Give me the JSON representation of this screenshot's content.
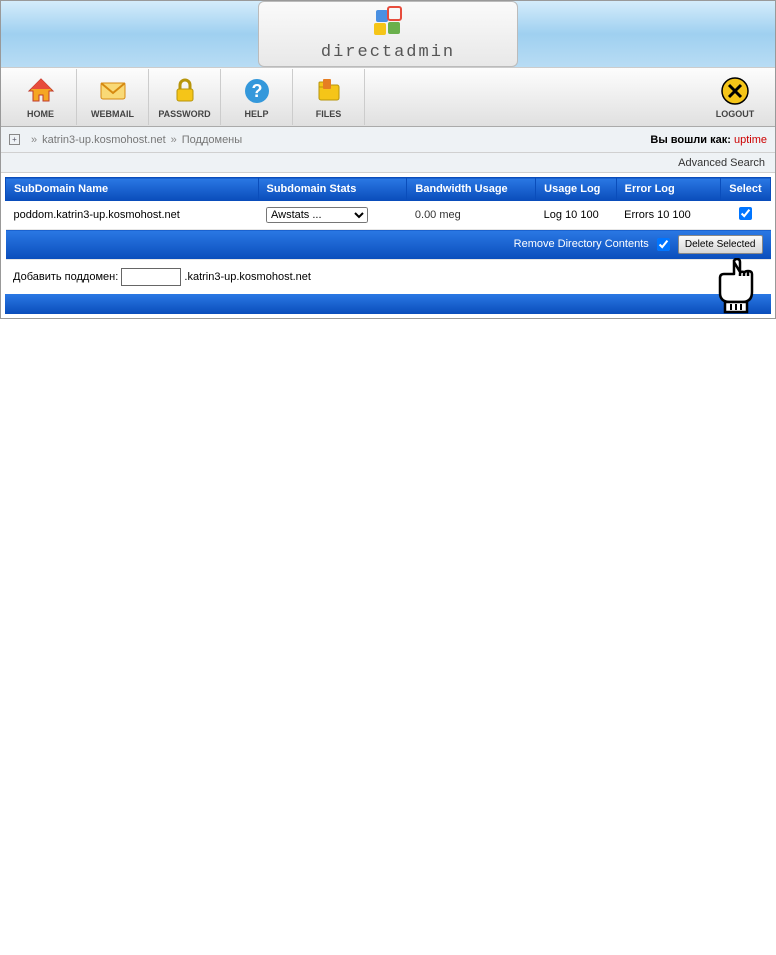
{
  "brand": "directadmin",
  "nav": {
    "home": "HOME",
    "webmail": "WEBMAIL",
    "password": "PASSWORD",
    "help": "HELP",
    "files": "FILES",
    "logout": "LOGOUT"
  },
  "breadcrumb": {
    "domain": "katrin3-up.kosmohost.net",
    "page": "Поддомены",
    "login_as_label": "Вы вошли как:",
    "login_user": "uptime"
  },
  "advanced_search": "Advanced Search",
  "headers": {
    "name": "SubDomain Name",
    "stats": "Subdomain Stats",
    "bw": "Bandwidth Usage",
    "log": "Usage Log",
    "err": "Error Log",
    "sel": "Select"
  },
  "row": {
    "name": "poddom.katrin3-up.kosmohost.net",
    "stats_selected": "Awstats ...",
    "bw": "0.00 meg",
    "log": "Log 10 100",
    "err": "Errors 10 100"
  },
  "actions": {
    "remove_dir": "Remove Directory Contents",
    "delete_selected": "Delete Selected"
  },
  "add": {
    "label": "Добавить поддомен:",
    "suffix": ".katrin3-up.kosmohost.net"
  }
}
